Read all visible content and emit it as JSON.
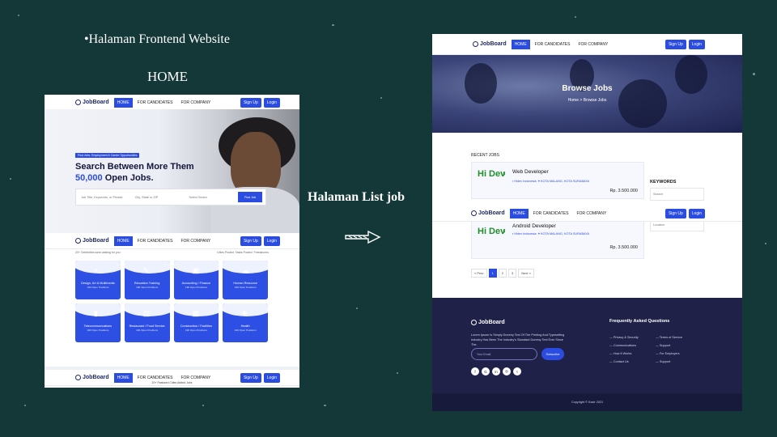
{
  "slide": {
    "title_frontend": "•Halaman Frontend Website",
    "title_home": "HOME",
    "title_list": "Halaman List job"
  },
  "home": {
    "nav": {
      "logo": "JobBoard",
      "home": "HOME",
      "candidates": "FOR CANDIDATES",
      "company": "FOR COMPANY",
      "signup": "Sign Up",
      "login": "Login"
    },
    "hero": {
      "tagline": "Find Jobs, Employment & Career Opportunities",
      "headline_1": "Search Between More Them",
      "headline_2a": "50,000",
      "headline_2b": " Open Jobs.",
      "search_placeholder": "Job Title, Keywords, or Phrase",
      "city_placeholder": "City, State or ZIP",
      "sector_placeholder": "Select Sector",
      "find_button": "Find Job"
    },
    "sub_left": "20+ Celebrities were waiting for you",
    "sub_right": [
      "Cities Posted",
      "Tasks Posted",
      "Freelancers"
    ],
    "categories": [
      {
        "icon": "⌖",
        "name": "Design, Art & Multimedia",
        "count": "190 Open Positions"
      },
      {
        "icon": "✎",
        "name": "Education Training",
        "count": "190 Open Positions"
      },
      {
        "icon": "▣",
        "name": "Accounting / Finance",
        "count": "190 Open Positions"
      },
      {
        "icon": "☁",
        "name": "Human Resource",
        "count": "190 Open Positions"
      },
      {
        "icon": "▮",
        "name": "Telecommunications",
        "count": "190 Open Positions"
      },
      {
        "icon": "▤",
        "name": "Restaurant / Food Service",
        "count": "190 Open Positions"
      },
      {
        "icon": "▦",
        "name": "Construction / Facilities",
        "count": "190 Open Positions"
      },
      {
        "icon": "✚",
        "name": "Health",
        "count": "190 Open Positions"
      }
    ],
    "footnote": "20+ Featured Cities Added Jobs"
  },
  "list": {
    "hero_title": "Browse Jobs",
    "breadcrumb": "Home > Browse Jobs",
    "recent_label": "RECENT JOBS",
    "jobs": [
      {
        "logo": "Hi Dev",
        "title": "Web Developer",
        "company": "Hidev Indonesia",
        "location": "KOTA MALANG, KOTA SURABAYA",
        "salary": "Rp. 3.500.000"
      },
      {
        "logo": "Hi Dev",
        "title": "Android Developer",
        "company": "Hidev Indonesia",
        "location": "KOTA MALANG, KOTA SURABAYA",
        "salary": "Rp. 3.500.000"
      }
    ],
    "keywords_label": "KEYWORDS",
    "search_placeholder": "Search",
    "location_placeholder": "Location",
    "pager": [
      "« Prev",
      "1",
      "2",
      "3",
      "Next »"
    ],
    "footer": {
      "logo": "JobBoard",
      "text": "Lorem Ipsum Is Simply Dummy Text Of The Printing And Typesetting Industry Has Been The Industry's Standard Dummy Text Ever Since The.",
      "email_placeholder": "Your Email",
      "subscribe": "Subscribe",
      "faq_title": "Frequently Asked Questions",
      "col1": [
        "— Privacy & Security",
        "— Communications",
        "— How It Works",
        "— Contact Us"
      ],
      "col2": [
        "— Terms of Service",
        "— Support",
        "— For Employers",
        "— Support"
      ],
      "socials": [
        "f",
        "G",
        "in",
        "◎",
        "t"
      ],
      "copyright": "Copyright © Kazir 2021"
    }
  },
  "colors": {
    "background": "#143838",
    "accent": "#2b4ce0",
    "footer": "#1f2148",
    "hidev_green": "#1e8f2a"
  }
}
